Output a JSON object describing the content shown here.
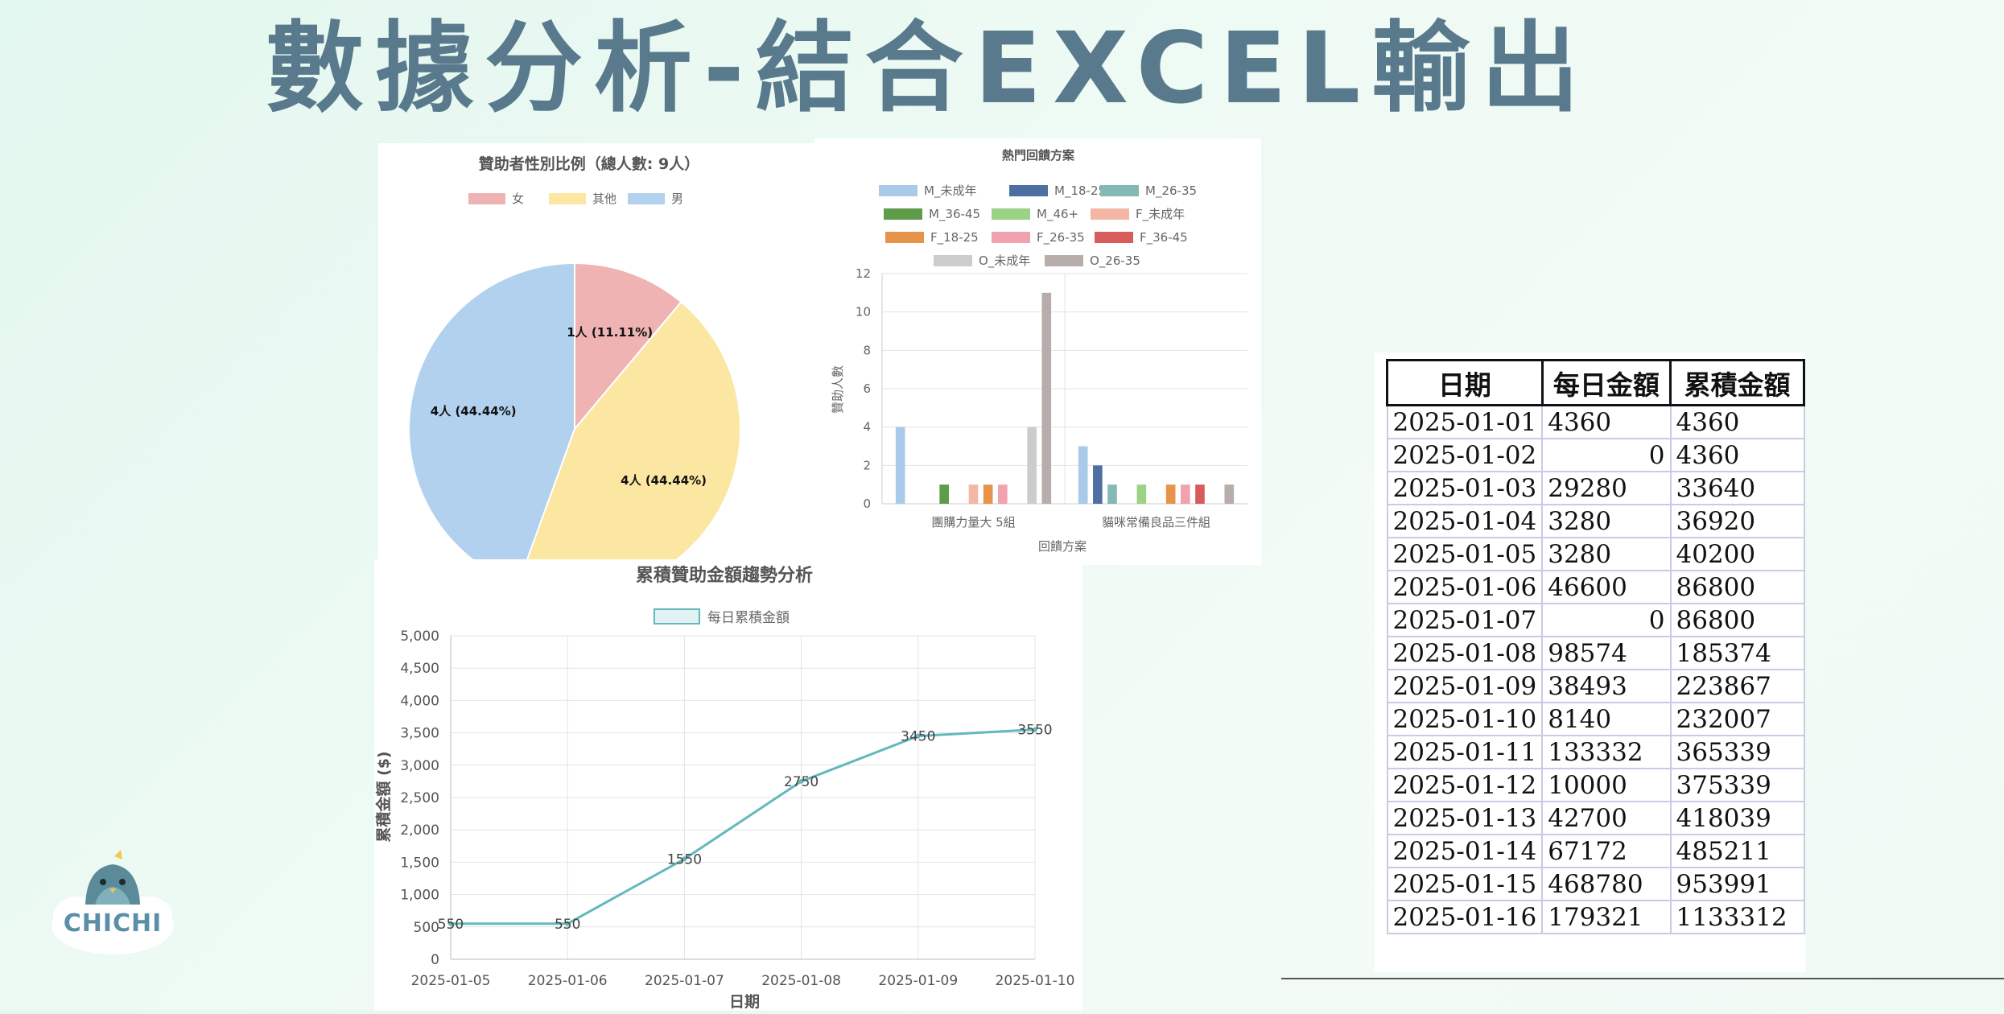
{
  "slide": {
    "title": "數據分析-結合EXCEL輸出",
    "logo_text": "CHICHI"
  },
  "colors": {
    "title": "#587a8c",
    "line": "#62b8bd",
    "pie_female": "#f0b3b3",
    "pie_other": "#fbe6a2",
    "pie_male": "#b1d1ee"
  },
  "chart_data": [
    {
      "type": "pie",
      "title": "贊助者性別比例（總人數: 9人）",
      "legend": {
        "placement": "top"
      },
      "slices": [
        {
          "name": "女",
          "value": 1,
          "label": "1人 (11.11%)",
          "color": "#f0b3b3"
        },
        {
          "name": "其他",
          "value": 4,
          "label": "4人 (44.44%)",
          "color": "#fbe6a2"
        },
        {
          "name": "男",
          "value": 4,
          "label": "4人 (44.44%)",
          "color": "#b1d1ee"
        }
      ]
    },
    {
      "type": "bar",
      "title": "熱門回饋方案",
      "xlabel": "回饋方案",
      "ylabel": "贊助人數",
      "ylim": [
        0,
        12
      ],
      "yticks": [
        0,
        2,
        4,
        6,
        8,
        10,
        12
      ],
      "grid": true,
      "legend": {
        "placement": "top"
      },
      "categories": [
        "團購力量大 5組",
        "貓咪常備良品三件組"
      ],
      "series": [
        {
          "name": "M_未成年",
          "color": "#a9cbe9",
          "values": [
            4,
            3
          ]
        },
        {
          "name": "M_18-25",
          "color": "#4e6fa1",
          "values": [
            0,
            2
          ]
        },
        {
          "name": "M_26-35",
          "color": "#84b9b6",
          "values": [
            0,
            1
          ]
        },
        {
          "name": "M_36-45",
          "color": "#5e9c4a",
          "values": [
            1,
            0
          ]
        },
        {
          "name": "M_46+",
          "color": "#9bd286",
          "values": [
            0,
            1
          ]
        },
        {
          "name": "F_未成年",
          "color": "#f4b7a5",
          "values": [
            1,
            0
          ]
        },
        {
          "name": "F_18-25",
          "color": "#e8934a",
          "values": [
            1,
            1
          ]
        },
        {
          "name": "F_26-35",
          "color": "#f1a2ae",
          "values": [
            1,
            1
          ]
        },
        {
          "name": "F_36-45",
          "color": "#d85c5c",
          "values": [
            0,
            1
          ]
        },
        {
          "name": "O_未成年",
          "color": "#cccccc",
          "values": [
            4,
            0
          ]
        },
        {
          "name": "O_26-35",
          "color": "#b7adaa",
          "values": [
            11,
            1
          ]
        }
      ]
    },
    {
      "type": "line",
      "title": "累積贊助金額趨勢分析",
      "xlabel": "日期",
      "ylabel": "累積金額 ($)",
      "ylim": [
        0,
        5000
      ],
      "yticks": [
        0,
        500,
        1000,
        1500,
        2000,
        2500,
        3000,
        3500,
        4000,
        4500,
        5000
      ],
      "ytick_labels": [
        "0",
        "500",
        "1,000",
        "1,500",
        "2,000",
        "2,500",
        "3,000",
        "3,500",
        "4,000",
        "4,500",
        "5,000"
      ],
      "grid": true,
      "legend": {
        "placement": "top"
      },
      "series": [
        {
          "name": "每日累積金額",
          "color": "#62b8bd",
          "x": [
            "2025-01-05",
            "2025-01-06",
            "2025-01-07",
            "2025-01-08",
            "2025-01-09",
            "2025-01-10"
          ],
          "values": [
            550,
            550,
            1550,
            2750,
            3450,
            3550
          ]
        }
      ]
    },
    {
      "type": "table",
      "columns": [
        "日期",
        "每日金額",
        "累積金額"
      ],
      "rows": [
        [
          "2025-01-01",
          "4360",
          "4360"
        ],
        [
          "2025-01-02",
          "0",
          "4360"
        ],
        [
          "2025-01-03",
          "29280",
          "33640"
        ],
        [
          "2025-01-04",
          "3280",
          "36920"
        ],
        [
          "2025-01-05",
          "3280",
          "40200"
        ],
        [
          "2025-01-06",
          "46600",
          "86800"
        ],
        [
          "2025-01-07",
          "0",
          "86800"
        ],
        [
          "2025-01-08",
          "98574",
          "185374"
        ],
        [
          "2025-01-09",
          "38493",
          "223867"
        ],
        [
          "2025-01-10",
          "8140",
          "232007"
        ],
        [
          "2025-01-11",
          "133332",
          "365339"
        ],
        [
          "2025-01-12",
          "10000",
          "375339"
        ],
        [
          "2025-01-13",
          "42700",
          "418039"
        ],
        [
          "2025-01-14",
          "67172",
          "485211"
        ],
        [
          "2025-01-15",
          "468780",
          "953991"
        ],
        [
          "2025-01-16",
          "179321",
          "1133312"
        ]
      ]
    }
  ]
}
